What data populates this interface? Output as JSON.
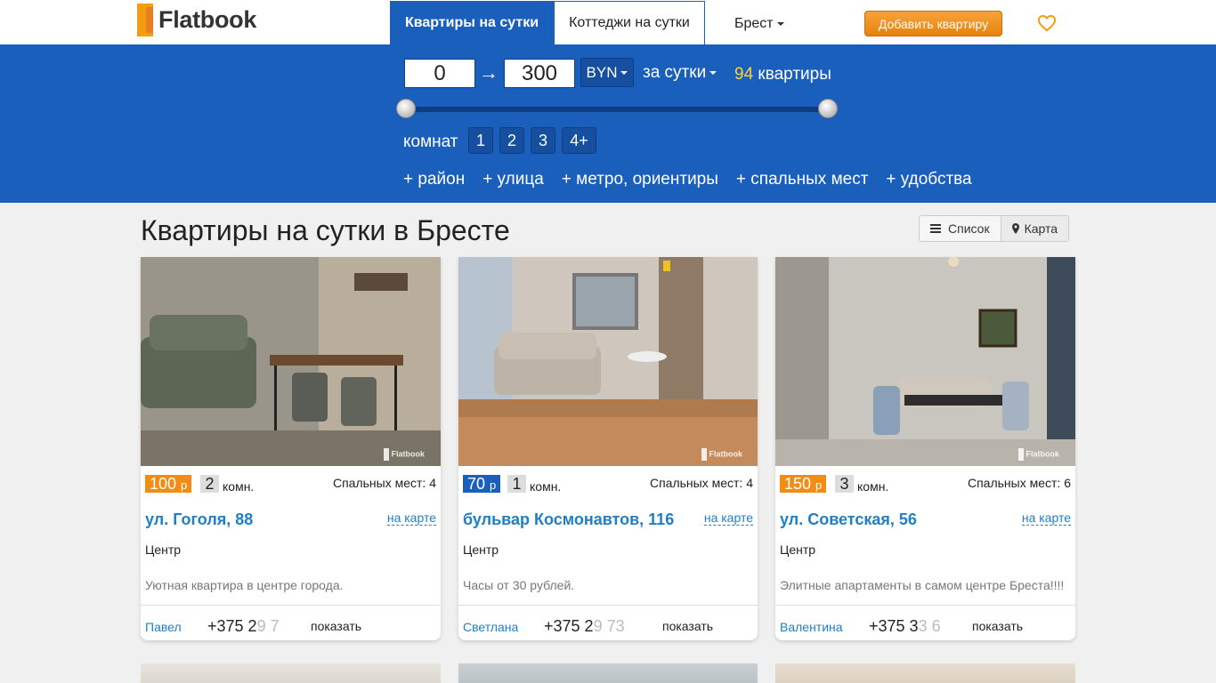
{
  "header": {
    "logo_text": "Flatbook",
    "tab_active": "Квартиры на сутки",
    "tab_other": "Коттеджи на сутки",
    "city": "Брест",
    "add_button": "Добавить квартиру",
    "favorites_icon": "heart-icon"
  },
  "filters": {
    "price_from": "0",
    "price_to": "300",
    "arrow": "→",
    "currency": "BYN",
    "period": "за сутки",
    "count": "94",
    "count_label": "квартиры",
    "price_range": [
      0,
      300
    ],
    "rooms_label": "комнат",
    "rooms": [
      "1",
      "2",
      "3",
      "4+"
    ],
    "more": [
      "+ район",
      "+ улица",
      "+ метро, ориентиры",
      "+ спальных мест",
      "+ удобства"
    ]
  },
  "main": {
    "title": "Квартиры на сутки в Бресте",
    "view_list": "Список",
    "view_map": "Карта"
  },
  "cards": [
    {
      "price": "100",
      "price_currency": "р",
      "price_color": "#f28c14",
      "rooms": "2",
      "rooms_suffix": "комн.",
      "sleep": "Спальных мест: 4",
      "address": "ул. Гоголя, 88",
      "map_link": "на карте",
      "district": "Центр",
      "description": "Уютная квартира в центре города.",
      "owner": "Павел",
      "phone_visible": "+375 2",
      "phone_fade": "9 7",
      "show": "показать",
      "watermark": "Flatbook"
    },
    {
      "price": "70",
      "price_currency": "р",
      "price_color": "#1b5fbd",
      "rooms": "1",
      "rooms_suffix": "комн.",
      "sleep": "Спальных мест: 4",
      "address": "бульвар Космонавтов, 116",
      "map_link": "на карте",
      "district": "Центр",
      "description": "Часы от 30 рублей.",
      "owner": "Светлана",
      "phone_visible": "+375 2",
      "phone_fade": "9 73",
      "show": "показать",
      "watermark": "Flatbook"
    },
    {
      "price": "150",
      "price_currency": "р",
      "price_color": "#f28c14",
      "rooms": "3",
      "rooms_suffix": "комн.",
      "sleep": "Спальных мест: 6",
      "address": "ул. Советская, 56",
      "map_link": "на карте",
      "district": "Центр",
      "description": "Элитные апартаменты в самом центре Бреста!!!!",
      "owner": "Валентина",
      "phone_visible": "+375 3",
      "phone_fade": "3 6",
      "show": "показать",
      "watermark": "Flatbook"
    }
  ]
}
